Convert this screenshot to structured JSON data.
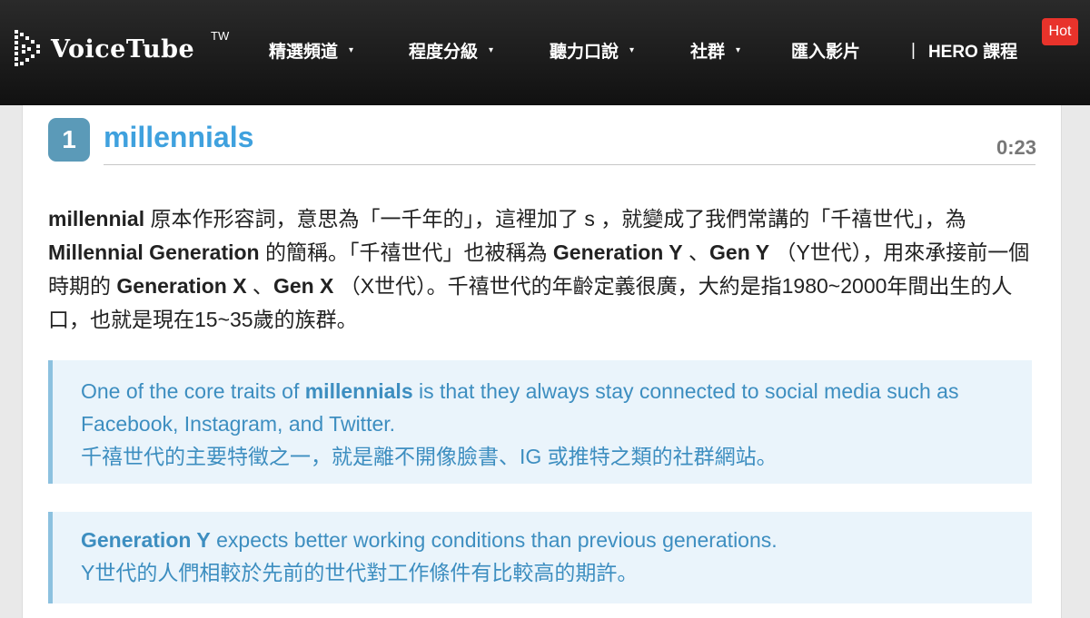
{
  "nav": {
    "logo_text": "VoiceTube",
    "logo_region": "TW",
    "items": [
      {
        "label": "精選頻道",
        "has_dropdown": true
      },
      {
        "label": "程度分級",
        "has_dropdown": true
      },
      {
        "label": "聽力口說",
        "has_dropdown": true
      },
      {
        "label": "社群",
        "has_dropdown": true
      },
      {
        "label": "匯入影片",
        "has_dropdown": false
      }
    ],
    "separator": "|",
    "hero_label": "HERO 課程",
    "hot_badge": "Hot",
    "caret": "▾"
  },
  "entry": {
    "number": "1",
    "word": "millennials",
    "timestamp": "0:23",
    "explanation": [
      {
        "b": true,
        "t": "millennial"
      },
      {
        "b": false,
        "t": " 原本作形容詞，意思為「一千年的」，這裡加了 s ，就變成了我們常講的「千禧世代」，為 "
      },
      {
        "b": true,
        "t": "Millennial Generation"
      },
      {
        "b": false,
        "t": " 的簡稱。「千禧世代」也被稱為 "
      },
      {
        "b": true,
        "t": "Generation Y"
      },
      {
        "b": false,
        "t": " 、"
      },
      {
        "b": true,
        "t": "Gen Y"
      },
      {
        "b": false,
        "t": " （Y世代），用來承接前一個時期的 "
      },
      {
        "b": true,
        "t": "Generation X"
      },
      {
        "b": false,
        "t": " 、"
      },
      {
        "b": true,
        "t": "Gen X"
      },
      {
        "b": false,
        "t": " （X世代）。千禧世代的年齡定義很廣，大約是指1980~2000年間出生的人口，也就是現在15~35歲的族群。"
      }
    ],
    "examples": [
      {
        "en_before": "One of the core traits of ",
        "en_bold": "millennials",
        "en_after": " is that they always stay connected to social media such as Facebook, Instagram, and Twitter.",
        "zh": "千禧世代的主要特徵之一，就是離不開像臉書、IG 或推特之類的社群網站。"
      },
      {
        "en_before": "",
        "en_bold": "Generation Y",
        "en_after": " expects better working conditions than previous generations.",
        "zh": "Y世代的人們相較於先前的世代對工作條件有比較高的期許。"
      }
    ]
  },
  "colors": {
    "accent_blue": "#3fa1de",
    "badge_blue": "#5b9ab8",
    "hot_red": "#e8332b",
    "example_bg": "#eaf4fb",
    "example_text": "#3d8ec0"
  }
}
